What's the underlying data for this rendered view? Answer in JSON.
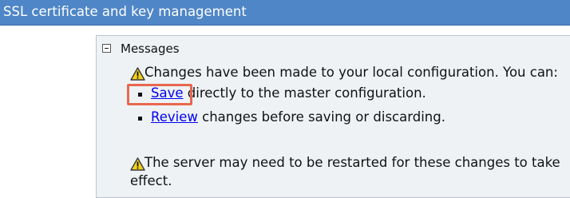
{
  "header": {
    "title": "SSL certificate and key management"
  },
  "messages": {
    "heading": "Messages",
    "collapse_icon": "minus-square-icon",
    "warning_icon": "warning-triangle-icon",
    "changes_text": "Changes have been made to your local configuration. You can:",
    "items": [
      {
        "link": "Save",
        "text": " directly to the master configuration."
      },
      {
        "link": "Review",
        "text": " changes before saving or discarding."
      }
    ],
    "restart_line1": "The server may need to be restarted for these changes to take",
    "restart_line2": "effect."
  },
  "colors": {
    "header_bg": "#4f86c7",
    "panel_bg": "#eef2f5",
    "link": "#0000ee",
    "highlight": "#e8674e"
  }
}
